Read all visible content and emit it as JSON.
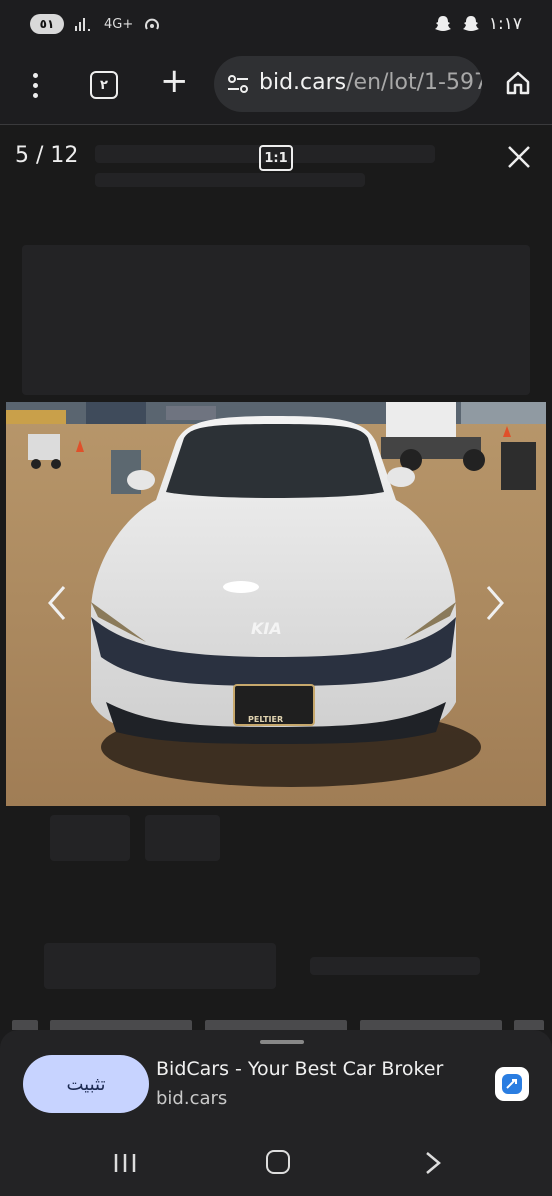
{
  "status_bar": {
    "battery": "٥١",
    "signal_text": "4G+",
    "time": "١:١٧"
  },
  "toolbar": {
    "tab_count": "٢",
    "url_host": "bid.cars",
    "url_path": "/en/lot/1-597"
  },
  "viewer": {
    "counter": "5 / 12",
    "ratio_label": "1:1",
    "image_description_icon": "car-photo",
    "plate_text": "PELTIER",
    "logo_text": "KIA"
  },
  "install_sheet": {
    "install_label": "تثبيت",
    "app_title": "BidCars - Your Best Car Broker",
    "app_host": "bid.cars"
  },
  "colors": {
    "background": "#1b1b1c",
    "install_button": "#c7d3ff",
    "url_bar": "#2f3033"
  }
}
